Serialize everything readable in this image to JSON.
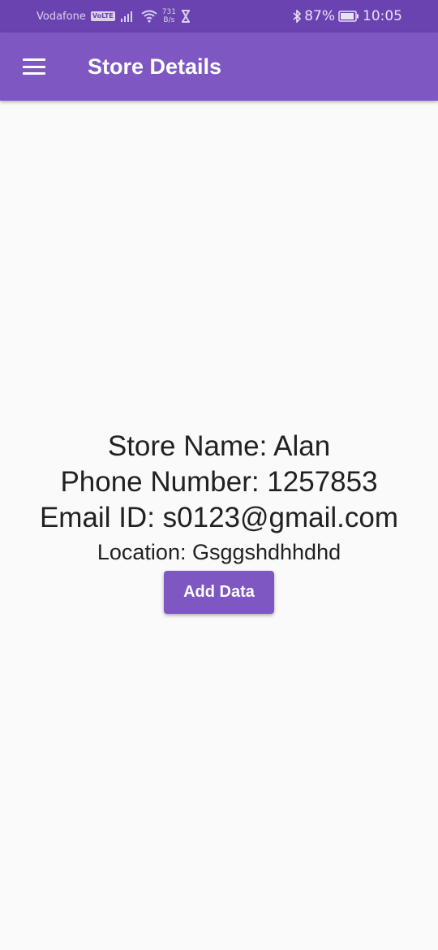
{
  "status_bar": {
    "carrier": "Vodafone",
    "volte": "VoLTE",
    "speed_value": "731",
    "speed_unit": "B/s",
    "battery": "87%",
    "time": "10:05"
  },
  "app_bar": {
    "title": "Store Details",
    "menu_icon": "menu-icon",
    "color": "#7e57c2"
  },
  "store": {
    "name_line": "Store Name: Alan",
    "phone_line": "Phone Number: 1257853",
    "email_line": "Email ID: s0123@gmail.com",
    "location_line": "Location: Gsggshdhhdhd"
  },
  "actions": {
    "add_data_label": "Add Data"
  }
}
